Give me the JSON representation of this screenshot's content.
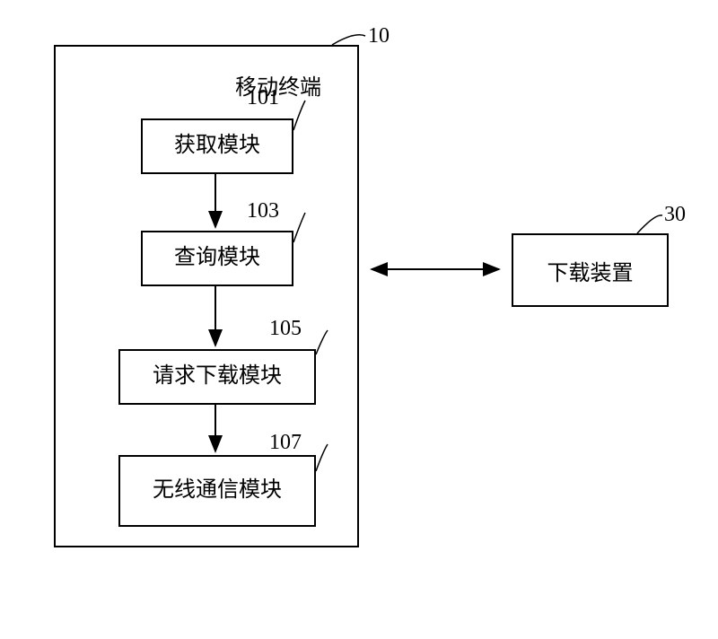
{
  "main": {
    "title": "移动终端",
    "label": "10",
    "modules": [
      {
        "name": "获取模块",
        "label": "101"
      },
      {
        "name": "查询模块",
        "label": "103"
      },
      {
        "name": "请求下载模块",
        "label": "105"
      },
      {
        "name": "无线通信模块",
        "label": "107"
      }
    ]
  },
  "right": {
    "name": "下载装置",
    "label": "30"
  }
}
